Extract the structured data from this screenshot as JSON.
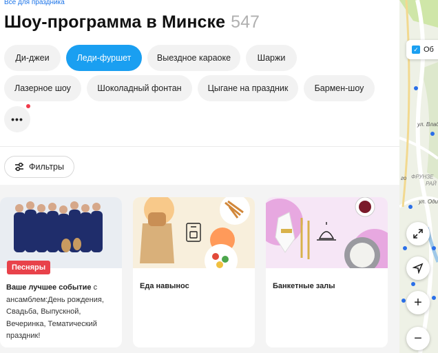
{
  "breadcrumb": "Все для праздника",
  "page": {
    "title": "Шоу-программа в Минске",
    "count": "547"
  },
  "chips": [
    {
      "label": "Ди-джеи",
      "active": false
    },
    {
      "label": "Леди-фуршет",
      "active": true
    },
    {
      "label": "Выездное караоке",
      "active": false
    },
    {
      "label": "Шаржи",
      "active": false
    },
    {
      "label": "Лазерное шоу",
      "active": false
    },
    {
      "label": "Шоколадный фонтан",
      "active": false
    },
    {
      "label": "Цыгане на праздник",
      "active": false
    },
    {
      "label": "Бармен-шоу",
      "active": false
    }
  ],
  "more_label": "•••",
  "filters_label": "Фильтры",
  "cards": [
    {
      "badge": "Песняры",
      "title": "Ваше лучшее событие",
      "text": " с ансамблем:День рождения, Свадьба, Выпускной, Вечеринка, Тематический праздник!"
    },
    {
      "title": "Еда навынос"
    },
    {
      "title": "Банкетные залы"
    }
  ],
  "map": {
    "checkbox_label": "Об",
    "labels": [
      "ул. Влад",
      "ФРУНЗЕ",
      "РАЙ",
      "ул. Одинц",
      "го"
    ],
    "zoom_in": "+",
    "zoom_out": "−"
  },
  "colors": {
    "accent": "#1a9ff1",
    "badge": "#e8424a"
  }
}
